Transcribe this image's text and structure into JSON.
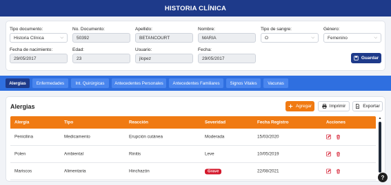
{
  "header": {
    "title": "HISTORIA CLÍNICA"
  },
  "patient": {
    "tipo_documento": {
      "label": "Tipo documento:",
      "value": "Historia Clínica"
    },
    "no_documento": {
      "label": "No. Documento:",
      "value": "50392"
    },
    "apellido": {
      "label": "Apellido:",
      "value": "BETANCOURT"
    },
    "nombre": {
      "label": "Nombre:",
      "value": "MARIA"
    },
    "tipo_sangre": {
      "label": "Tipo de sangre:",
      "value": "O"
    },
    "genero": {
      "label": "Género:",
      "value": "Femenino"
    },
    "fecha_nacimiento": {
      "label": "Fecha de nacimiento:",
      "value": "29/05/2017"
    },
    "edad": {
      "label": "Edad:",
      "value": "23"
    },
    "usuario": {
      "label": "Usuario:",
      "value": "jlopez"
    },
    "fecha": {
      "label": "Fecha:",
      "value": "29/05/2017"
    },
    "save_label": "Guardar"
  },
  "tabs": [
    {
      "label": "Alergias",
      "active": true
    },
    {
      "label": "Enfermedades"
    },
    {
      "label": "Int. Quirúrgicas"
    },
    {
      "label": "Antecedentes Personales"
    },
    {
      "label": "Antecedentes Familiares"
    },
    {
      "label": "Signos Vitales"
    },
    {
      "label": "Vacunas"
    }
  ],
  "allergies": {
    "title": "Alergias",
    "add_label": "Agregar",
    "print_label": "Imprimir",
    "export_label": "Exportar",
    "columns": [
      "Alergia",
      "Tipo",
      "Reacción",
      "Severidad",
      "Fecha Registro",
      "Acciones"
    ],
    "rows": [
      {
        "alergia": "Penicilina",
        "tipo": "Medicamento",
        "reaccion": "Erupción cutánea",
        "severidad": "Moderada",
        "fecha": "15/03/2020"
      },
      {
        "alergia": "Polen",
        "tipo": "Ambiental",
        "reaccion": "Rinitis",
        "severidad": "Leve",
        "fecha": "10/05/2019"
      },
      {
        "alergia": "Mariscos",
        "tipo": "Alimentaria",
        "reaccion": "Hinchazón",
        "severidad": "Grave",
        "fecha": "22/08/2021"
      }
    ]
  },
  "colors": {
    "header": "#1e3a8a",
    "tabbar": "#2f6fe0",
    "accent": "#f07a12",
    "severe": "#d4192c"
  },
  "help_label": "?"
}
